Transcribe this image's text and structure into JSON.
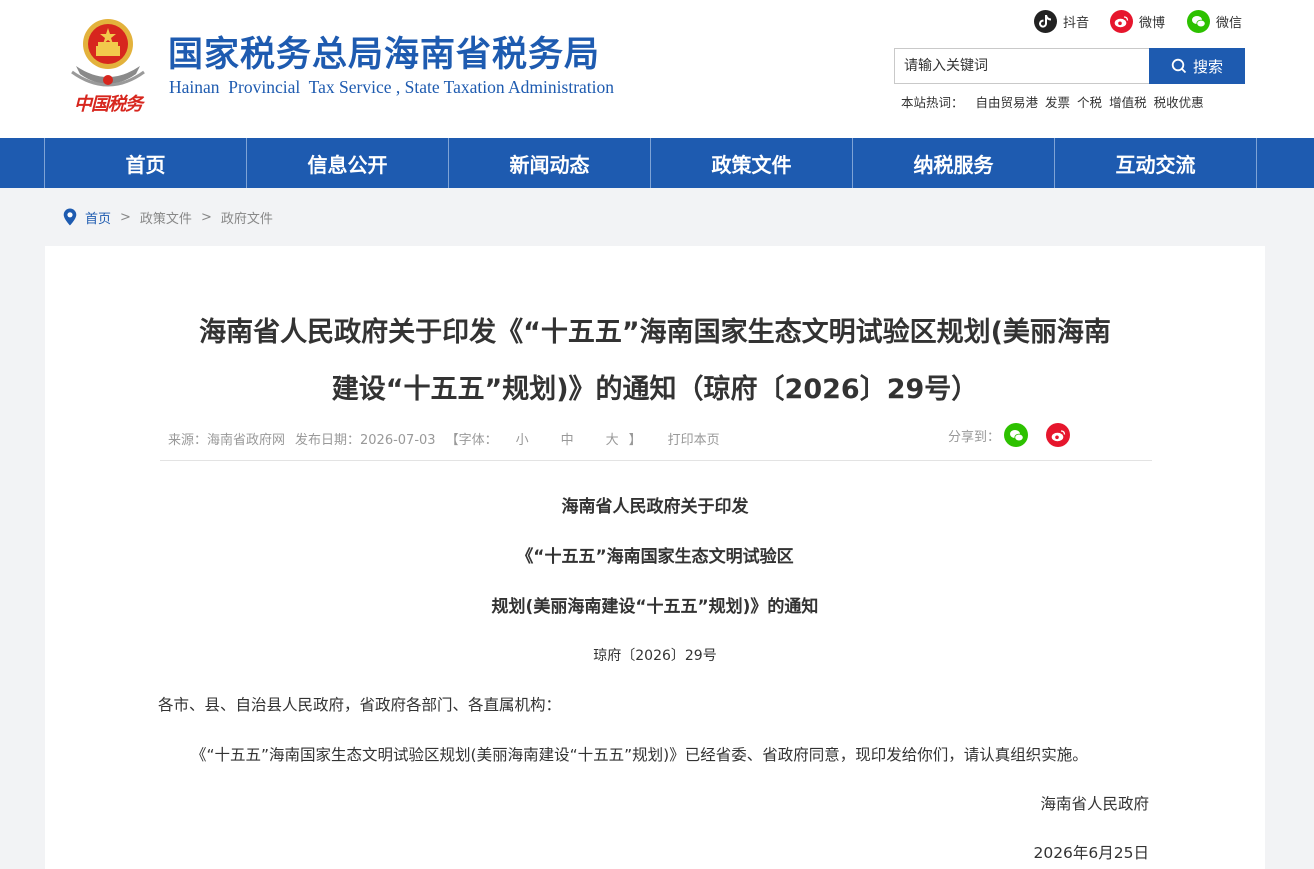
{
  "header": {
    "title": "国家税务总局海南省税务局",
    "subtitle": "Hainan  Provincial  Tax Service , State Taxation Administration",
    "logo_text": "中国税务"
  },
  "social": {
    "douyin": "抖音",
    "weibo": "微博",
    "weixin": "微信"
  },
  "search": {
    "placeholder": "请输入关键词",
    "button": "搜索"
  },
  "hotwords": {
    "label": "本站热词：",
    "items": [
      "自由贸易港",
      "发票",
      "个税",
      "增值税",
      "税收优惠"
    ]
  },
  "nav": {
    "items": [
      "首页",
      "信息公开",
      "新闻动态",
      "政策文件",
      "纳税服务",
      "互动交流"
    ]
  },
  "breadcrumb": {
    "home": "首页",
    "items": [
      "政策文件",
      "政府文件"
    ],
    "sep": ">"
  },
  "article": {
    "title_line1": "海南省人民政府关于印发《“十五五”海南国家生态文明试验区规划(美丽海南",
    "title_line2": "建设“十五五”规划)》的通知（琼府〔2026〕29号）",
    "source": "来源：海南省政府网",
    "date": "发布日期：2026-07-03",
    "font_label": "【字体：",
    "font_small": "小",
    "font_medium": "中",
    "font_large": "大",
    "font_end": "】",
    "print": "打印本页",
    "share": "分享到："
  },
  "body": {
    "head1": "海南省人民政府关于印发",
    "head2": "《“十五五”海南国家生态文明试验区",
    "head3": "规划(美丽海南建设“十五五”规划)》的通知",
    "doc_no": "琼府〔2026〕29号",
    "salutation": "各市、县、自治县人民政府，省政府各部门、各直属机构：",
    "para": "《“十五五”海南国家生态文明试验区规划(美丽海南建设“十五五”规划)》已经省委、省政府同意，现印发给你们，请认真组织实施。",
    "signature": "海南省人民政府",
    "sign_date": "2026年6月25日"
  },
  "colors": {
    "brand_blue": "#1e5bb0",
    "wechat_green": "#2dc100",
    "weibo_red": "#e6162d"
  }
}
